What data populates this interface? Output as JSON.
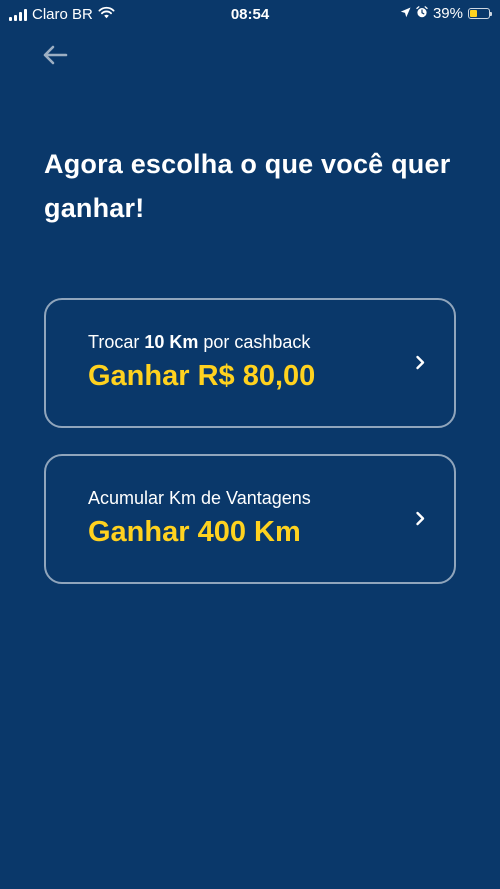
{
  "status_bar": {
    "carrier": "Claro BR",
    "time": "08:54",
    "battery_percent": "39%",
    "battery_level": 0.39,
    "icons": [
      "signal-icon",
      "wifi-icon",
      "location-arrow-icon",
      "alarm-icon",
      "battery-icon"
    ]
  },
  "header": {
    "back_icon": "arrow-left-icon",
    "title": "Agora escolha o que você quer ganhar!"
  },
  "options": [
    {
      "desc_prefix": "Trocar ",
      "desc_bold": "10 Km",
      "desc_suffix": " por cashback",
      "value": "Ganhar R$ 80,00",
      "icon": "chevron-right-icon"
    },
    {
      "desc_prefix": "Acumular Km de Vantagens",
      "desc_bold": "",
      "desc_suffix": "",
      "value": "Ganhar 400 Km",
      "icon": "chevron-right-icon"
    }
  ],
  "colors": {
    "background": "#0a386a",
    "accent": "#ffd21f",
    "card_border": "rgba(255,255,255,0.55)",
    "text": "#ffffff"
  }
}
